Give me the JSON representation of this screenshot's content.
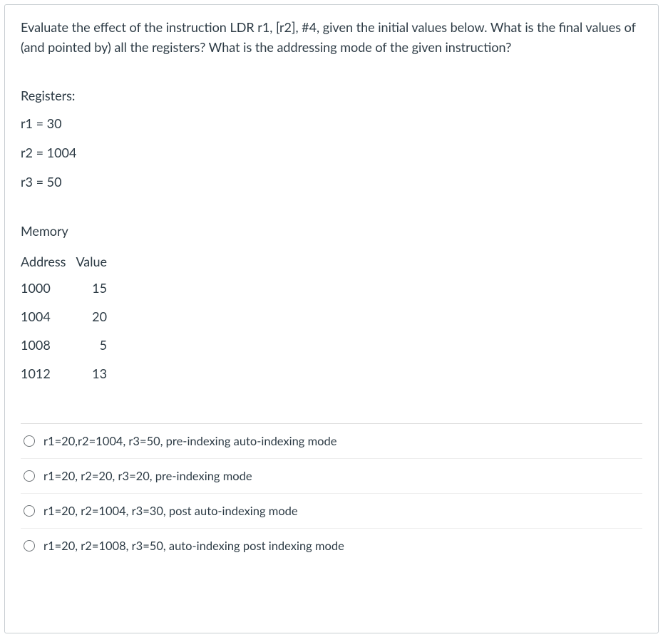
{
  "question": "Evaluate the effect of the instruction LDR r1, [r2], #4, given the initial values below. What is the final values of (and pointed by) all the registers? What is the addressing mode of the given instruction?",
  "registers": {
    "label": "Registers:",
    "lines": [
      "r1 = 30",
      "r2 = 1004",
      "r3 = 50"
    ]
  },
  "memory": {
    "label": "Memory",
    "headers": {
      "address": "Address",
      "value": "Value"
    },
    "rows": [
      {
        "address": "1000",
        "value": "15"
      },
      {
        "address": "1004",
        "value": "20"
      },
      {
        "address": "1008",
        "value": "5"
      },
      {
        "address": "1012",
        "value": "13"
      }
    ]
  },
  "answers": [
    "r1=20,r2=1004, r3=50, pre-indexing auto-indexing mode",
    "r1=20, r2=20, r3=20, pre-indexing mode",
    "r1=20, r2=1004, r3=30, post auto-indexing mode",
    "r1=20, r2=1008, r3=50, auto-indexing post indexing mode"
  ]
}
